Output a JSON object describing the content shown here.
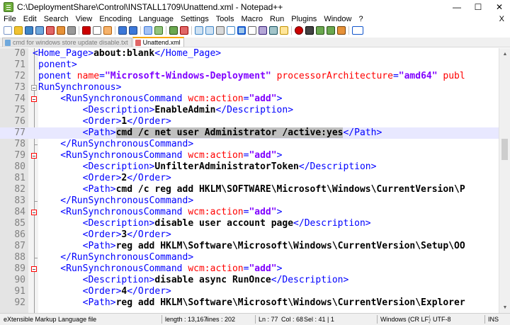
{
  "window": {
    "title": "C:\\DeploymentShare\\Control\\INSTALL1709\\Unattend.xml - Notepad++",
    "minimize": "—",
    "maximize": "☐",
    "close": "✕"
  },
  "menu": {
    "items": [
      "File",
      "Edit",
      "Search",
      "View",
      "Encoding",
      "Language",
      "Settings",
      "Tools",
      "Macro",
      "Run",
      "Plugins",
      "Window",
      "?"
    ],
    "close_glyph": "X"
  },
  "tabs": [
    {
      "label": "cmd for windows store update disable.txt",
      "active": false
    },
    {
      "label": "Unattend.xml",
      "active": true
    }
  ],
  "editor": {
    "lines": [
      {
        "n": "70",
        "tokens": [
          {
            "t": "<Home_Page>",
            "c": "tag",
            "clip": 1
          },
          {
            "t": "about:blank",
            "c": "txt"
          },
          {
            "t": "</Home_Page>",
            "c": "tag"
          }
        ]
      },
      {
        "n": "71",
        "tokens": [
          {
            "t": "ponent>",
            "c": "tag"
          }
        ]
      },
      {
        "n": "72",
        "tokens": [
          {
            "t": "ponent ",
            "c": "tag"
          },
          {
            "t": "name",
            "c": "attr"
          },
          {
            "t": "=",
            "c": "tag"
          },
          {
            "t": "\"Microsoft-Windows-Deployment\"",
            "c": "val"
          },
          {
            "t": " ",
            "c": "tag"
          },
          {
            "t": "processorArchitecture",
            "c": "attr"
          },
          {
            "t": "=",
            "c": "tag"
          },
          {
            "t": "\"amd64\"",
            "c": "val"
          },
          {
            "t": " publ",
            "c": "attr"
          }
        ]
      },
      {
        "n": "73",
        "tokens": [
          {
            "t": "RunSynchronous>",
            "c": "tag"
          }
        ]
      },
      {
        "n": "74",
        "tokens": [
          {
            "t": "    <RunSynchronousCommand ",
            "c": "tag"
          },
          {
            "t": "wcm:action",
            "c": "attr"
          },
          {
            "t": "=",
            "c": "tag"
          },
          {
            "t": "\"add\"",
            "c": "val"
          },
          {
            "t": ">",
            "c": "tag"
          }
        ]
      },
      {
        "n": "75",
        "tokens": [
          {
            "t": "        <Description>",
            "c": "tag"
          },
          {
            "t": "EnableAdmin",
            "c": "txt"
          },
          {
            "t": "</Description>",
            "c": "tag"
          }
        ]
      },
      {
        "n": "76",
        "tokens": [
          {
            "t": "        <Order>",
            "c": "tag"
          },
          {
            "t": "1",
            "c": "txt"
          },
          {
            "t": "</Order>",
            "c": "tag"
          }
        ]
      },
      {
        "n": "77",
        "tokens": [
          {
            "t": "        <Path>",
            "c": "tag"
          },
          {
            "t": "cmd /c net user Administrator /active:yes",
            "c": "txt sel"
          },
          {
            "t": "</Path>",
            "c": "tag"
          }
        ]
      },
      {
        "n": "78",
        "tokens": [
          {
            "t": "    </RunSynchronousCommand>",
            "c": "tag"
          }
        ]
      },
      {
        "n": "79",
        "tokens": [
          {
            "t": "    <RunSynchronousCommand ",
            "c": "tag"
          },
          {
            "t": "wcm:action",
            "c": "attr"
          },
          {
            "t": "=",
            "c": "tag"
          },
          {
            "t": "\"add\"",
            "c": "val"
          },
          {
            "t": ">",
            "c": "tag"
          }
        ]
      },
      {
        "n": "80",
        "tokens": [
          {
            "t": "        <Description>",
            "c": "tag"
          },
          {
            "t": "UnfilterAdministratorToken",
            "c": "txt"
          },
          {
            "t": "</Description>",
            "c": "tag"
          }
        ]
      },
      {
        "n": "81",
        "tokens": [
          {
            "t": "        <Order>",
            "c": "tag"
          },
          {
            "t": "2",
            "c": "txt"
          },
          {
            "t": "</Order>",
            "c": "tag"
          }
        ]
      },
      {
        "n": "82",
        "tokens": [
          {
            "t": "        <Path>",
            "c": "tag"
          },
          {
            "t": "cmd /c reg add HKLM\\SOFTWARE\\Microsoft\\Windows\\CurrentVersion\\P",
            "c": "txt"
          }
        ]
      },
      {
        "n": "83",
        "tokens": [
          {
            "t": "    </RunSynchronousCommand>",
            "c": "tag"
          }
        ]
      },
      {
        "n": "84",
        "tokens": [
          {
            "t": "    <RunSynchronousCommand ",
            "c": "tag"
          },
          {
            "t": "wcm:action",
            "c": "attr"
          },
          {
            "t": "=",
            "c": "tag"
          },
          {
            "t": "\"add\"",
            "c": "val"
          },
          {
            "t": ">",
            "c": "tag"
          }
        ]
      },
      {
        "n": "85",
        "tokens": [
          {
            "t": "        <Description>",
            "c": "tag"
          },
          {
            "t": "disable user account page",
            "c": "txt"
          },
          {
            "t": "</Description>",
            "c": "tag"
          }
        ]
      },
      {
        "n": "86",
        "tokens": [
          {
            "t": "        <Order>",
            "c": "tag"
          },
          {
            "t": "3",
            "c": "txt"
          },
          {
            "t": "</Order>",
            "c": "tag"
          }
        ]
      },
      {
        "n": "87",
        "tokens": [
          {
            "t": "        <Path>",
            "c": "tag"
          },
          {
            "t": "reg add HKLM\\Software\\Microsoft\\Windows\\CurrentVersion\\Setup\\OO",
            "c": "txt"
          }
        ]
      },
      {
        "n": "88",
        "tokens": [
          {
            "t": "    </RunSynchronousCommand>",
            "c": "tag"
          }
        ]
      },
      {
        "n": "89",
        "tokens": [
          {
            "t": "    <RunSynchronousCommand ",
            "c": "tag"
          },
          {
            "t": "wcm:action",
            "c": "attr"
          },
          {
            "t": "=",
            "c": "tag"
          },
          {
            "t": "\"add\"",
            "c": "val"
          },
          {
            "t": ">",
            "c": "tag"
          }
        ]
      },
      {
        "n": "90",
        "tokens": [
          {
            "t": "        <Description>",
            "c": "tag"
          },
          {
            "t": "disable async RunOnce",
            "c": "txt"
          },
          {
            "t": "</Description>",
            "c": "tag"
          }
        ]
      },
      {
        "n": "91",
        "tokens": [
          {
            "t": "        <Order>",
            "c": "tag"
          },
          {
            "t": "4",
            "c": "txt"
          },
          {
            "t": "</Order>",
            "c": "tag"
          }
        ]
      },
      {
        "n": "92",
        "tokens": [
          {
            "t": "        <Path>",
            "c": "tag"
          },
          {
            "t": "reg add HKLM\\Software\\Microsoft\\Windows\\CurrentVersion\\Explorer",
            "c": "txt"
          }
        ]
      }
    ],
    "current_line": "77"
  },
  "status": {
    "file_type": "eXtensible Markup Language file",
    "length": "length : 13,167",
    "lines": "lines : 202",
    "ln": "Ln : 77",
    "col": "Col : 68",
    "sel": "Sel : 41 | 1",
    "eol": "Windows (CR LF)",
    "encoding": "UTF-8",
    "mode": "INS"
  },
  "colors": {
    "tag": "#0000ff",
    "attribute": "#ff0000",
    "value": "#8000ff",
    "selection": "#c0c0c0",
    "current_line": "#e8e8ff"
  }
}
